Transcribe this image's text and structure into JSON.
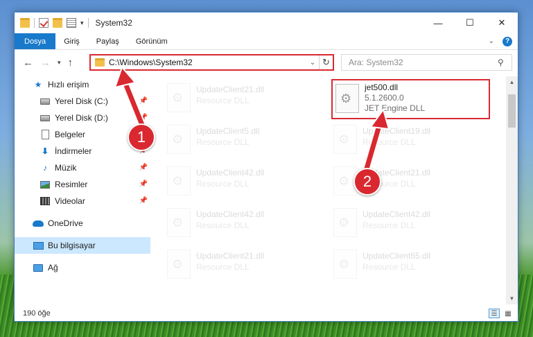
{
  "window": {
    "title": "System32",
    "controls": {
      "minimize": "—",
      "maximize": "☐",
      "close": "✕"
    }
  },
  "ribbon": {
    "tabs": [
      {
        "label": "Dosya"
      },
      {
        "label": "Giriş"
      },
      {
        "label": "Paylaş"
      },
      {
        "label": "Görünüm"
      }
    ],
    "expand_icon": "chevron-down-icon",
    "help_label": "?"
  },
  "nav": {
    "address_path": "C:\\Windows\\System32",
    "search_placeholder": "Ara: System32"
  },
  "sidebar": {
    "items": [
      {
        "label": "Hızlı erişim",
        "icon": "star-icon"
      },
      {
        "label": "Yerel Disk (C:)",
        "icon": "disk-icon",
        "pinned": true
      },
      {
        "label": "Yerel Disk (D:)",
        "icon": "disk-icon",
        "pinned": true
      },
      {
        "label": "Belgeler",
        "icon": "document-icon",
        "pinned": true
      },
      {
        "label": "İndirmeler",
        "icon": "download-icon",
        "pinned": true
      },
      {
        "label": "Müzik",
        "icon": "music-icon",
        "pinned": true
      },
      {
        "label": "Resimler",
        "icon": "pictures-icon",
        "pinned": true
      },
      {
        "label": "Videolar",
        "icon": "videos-icon",
        "pinned": true
      },
      {
        "label": "OneDrive",
        "icon": "cloud-icon"
      },
      {
        "label": "Bu bilgisayar",
        "icon": "computer-icon",
        "selected": true
      },
      {
        "label": "Ağ",
        "icon": "network-icon"
      }
    ]
  },
  "files": {
    "left_column": [
      {
        "name": "UpdateClient21.dll",
        "type": "Resource DLL"
      },
      {
        "name": "UpdateClient5.dll",
        "type": "Resource DLL"
      },
      {
        "name": "UpdateClient42.dll",
        "type": "Resource DLL"
      },
      {
        "name": "UpdateClient42.dll",
        "type": "Resource DLL"
      },
      {
        "name": "UpdateClient21.dll",
        "type": "Resource DLL"
      }
    ],
    "right_column": [
      {
        "name": "jet500.dll",
        "version": "5.1.2600.0",
        "type": "JET Engine DLL"
      },
      {
        "name": "UpdateClient19.dll",
        "type": "Resource DLL"
      },
      {
        "name": "UpdateClient21.dll",
        "type": "Resource DLL"
      },
      {
        "name": "UpdateClient42.dll",
        "type": "Resource DLL"
      },
      {
        "name": "UpdateClient65.dll",
        "type": "Resource DLL"
      }
    ]
  },
  "status": {
    "item_count": "190 öğe"
  },
  "annotations": {
    "step1": "1",
    "step2": "2",
    "color": "#d9282f"
  }
}
